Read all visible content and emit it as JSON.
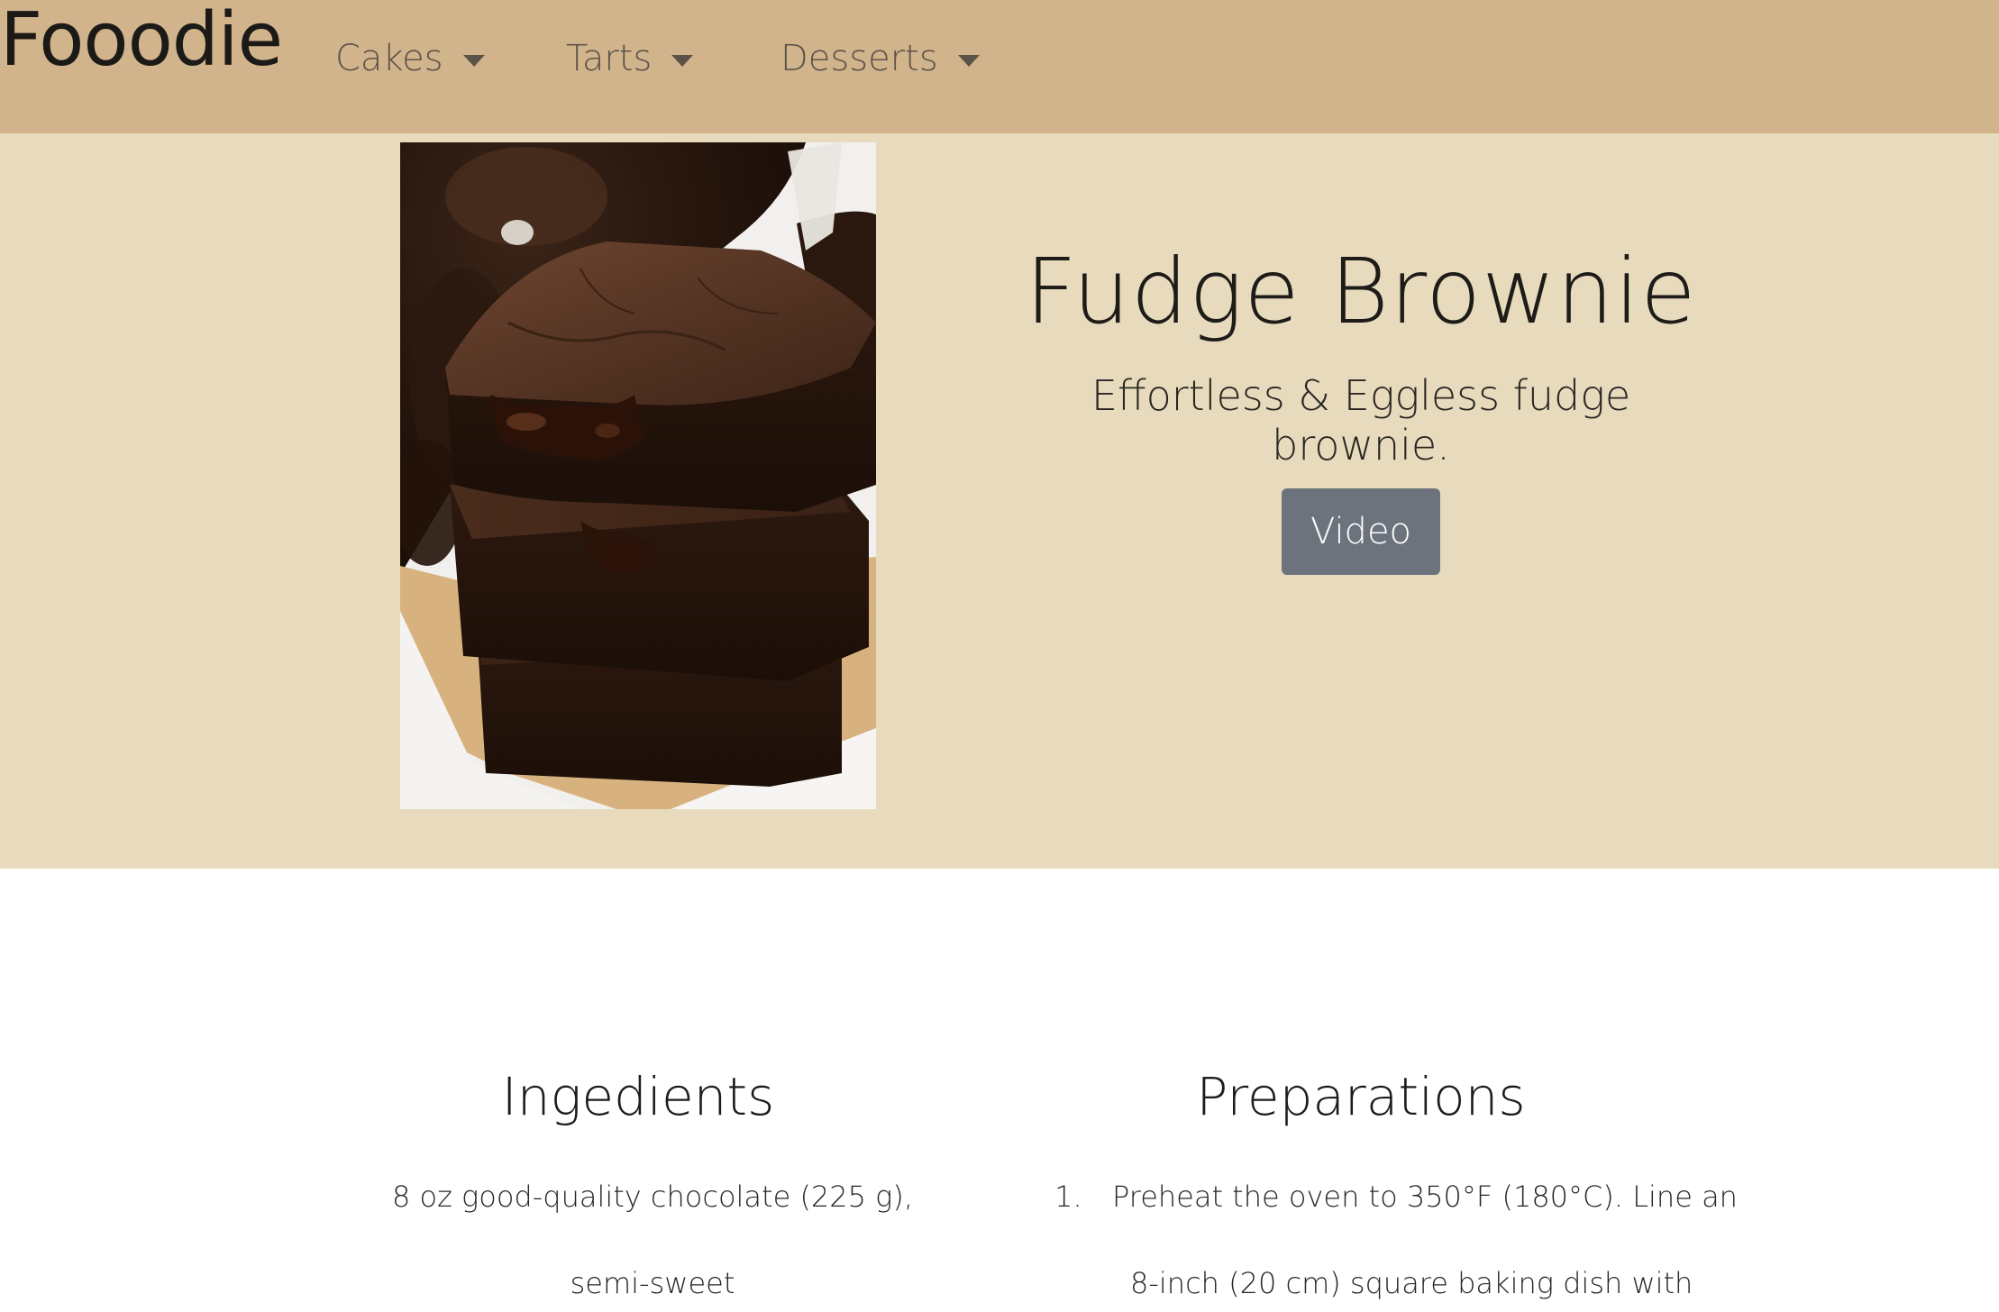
{
  "navbar": {
    "brand": "Fooodie",
    "items": [
      {
        "label": "Cakes"
      },
      {
        "label": "Tarts"
      },
      {
        "label": "Desserts"
      }
    ]
  },
  "hero": {
    "title": "Fudge Brownie",
    "subtitle": "Effortless & Eggless fudge brownie.",
    "video_button": "Video"
  },
  "ingredients": {
    "heading": "Ingedients",
    "lines": [
      "8 oz good-quality chocolate (225 g),",
      "semi-sweet"
    ]
  },
  "preparations": {
    "heading": "Preparations",
    "steps": [
      {
        "number": "1.",
        "lines": [
          "Preheat the oven to 350°F (180°C). Line an",
          "8-inch (20 cm) square baking dish with"
        ]
      }
    ]
  },
  "colors": {
    "navbar_bg": "#d2b48c",
    "hero_bg": "#e8dbbd",
    "button_bg": "#6c737c"
  }
}
